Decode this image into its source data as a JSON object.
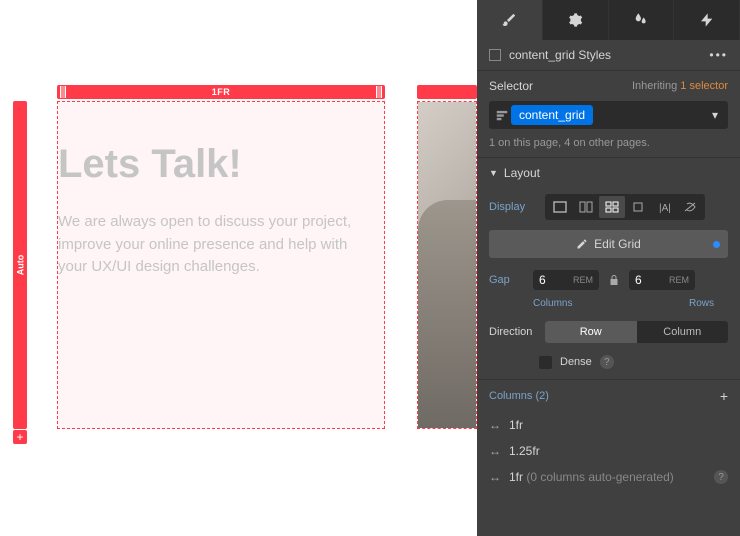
{
  "canvas": {
    "col_label": "1FR",
    "row_label": "Auto",
    "heading": "Lets Talk!",
    "paragraph": "We are always open to discuss your project, improve your online presence and help with your UX/UI design challenges."
  },
  "panel": {
    "style_title": "content_grid Styles",
    "selector_label": "Selector",
    "inheriting_label": "Inheriting",
    "inheriting_count": "1 selector",
    "selector_pill": "content_grid",
    "selector_info": "1 on this page, 4 on other pages.",
    "layout_label": "Layout",
    "display_label": "Display",
    "edit_grid_label": "Edit Grid",
    "gap_label": "Gap",
    "gap_col_value": "6",
    "gap_col_unit": "REM",
    "gap_row_value": "6",
    "gap_row_unit": "REM",
    "gap_col_sublabel": "Columns",
    "gap_row_sublabel": "Rows",
    "direction_label": "Direction",
    "direction_row": "Row",
    "direction_column": "Column",
    "dense_label": "Dense",
    "columns_header": "Columns (2)",
    "columns": {
      "c0": "1fr",
      "c1": "1.25fr",
      "c2_prefix": "1fr",
      "c2_suffix": "(0 columns auto-generated)"
    }
  }
}
